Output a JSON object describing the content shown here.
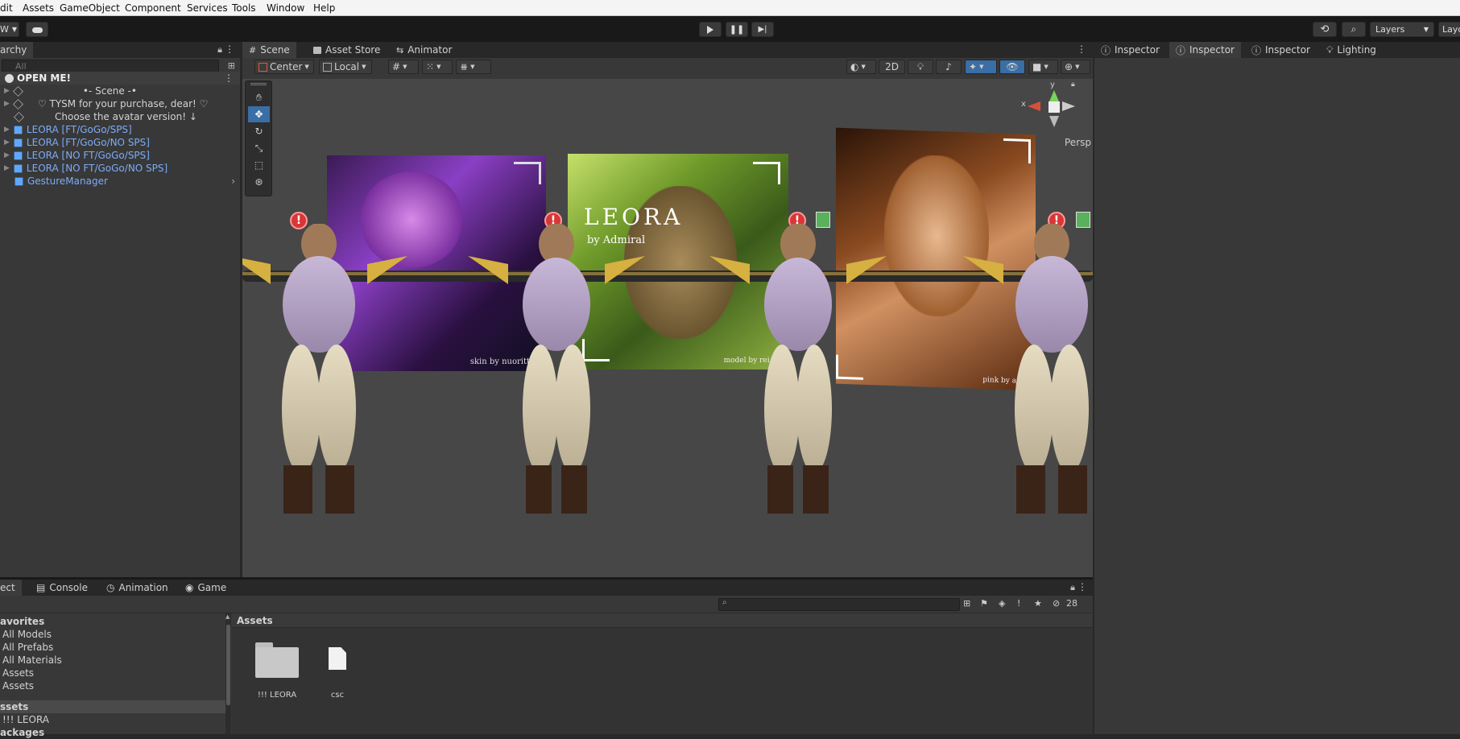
{
  "menu": [
    "dit",
    "Assets",
    "GameObject",
    "Component",
    "Services",
    "Tools",
    "Window",
    "Help"
  ],
  "toolbar": {
    "account_label": "W",
    "layers_label": "Layers",
    "layout_label": "Layo"
  },
  "hierarchy": {
    "tab_label": "archy",
    "search_placeholder": "All",
    "scene_name": "OPEN ME!",
    "items": [
      {
        "label": "•- Scene -•"
      },
      {
        "label": "♡ TYSM for your purchase, dear! ♡"
      },
      {
        "label": "Choose the avatar version! ↓"
      },
      {
        "label": "LEORA [FT/GoGo/SPS]"
      },
      {
        "label": "LEORA [FT/GoGo/NO SPS]"
      },
      {
        "label": "LEORA [NO FT/GoGo/SPS]"
      },
      {
        "label": "LEORA [NO FT/GoGo/NO SPS]"
      },
      {
        "label": "GestureManager"
      }
    ]
  },
  "scene_tabs": [
    {
      "label": "Scene"
    },
    {
      "label": "Asset Store"
    },
    {
      "label": "Animator"
    }
  ],
  "scene_toolbar": {
    "pivot": "Center",
    "space": "Local",
    "mode_2d": "2D"
  },
  "gizmo": {
    "y": "y",
    "x": "x",
    "projection": "Persp"
  },
  "posters": [
    {
      "title": "",
      "caption": "skin by nuoritt"
    },
    {
      "title": "LEORA",
      "subtitle": "by Admiral",
      "caption": "model by rei.ky"
    },
    {
      "title": "",
      "caption": "pink by ai-ly"
    }
  ],
  "inspector_tabs": [
    {
      "label": "Inspector"
    },
    {
      "label": "Inspector"
    },
    {
      "label": "Inspector"
    },
    {
      "label": "Lighting"
    }
  ],
  "bottom_tabs": [
    {
      "label": "ect"
    },
    {
      "label": "Console"
    },
    {
      "label": "Animation"
    },
    {
      "label": "Game"
    }
  ],
  "project": {
    "hidden_count": "28",
    "favorites_header": "avorites",
    "favorites": [
      "All Models",
      "All Prefabs",
      "All Materials",
      "Assets",
      "Assets"
    ],
    "assets_header": "ssets",
    "assets_children": [
      "!!! LEORA"
    ],
    "packages_header": "ackages",
    "breadcrumb": "Assets",
    "grid": [
      {
        "name": "!!! LEORA",
        "type": "folder"
      },
      {
        "name": "csc",
        "type": "file"
      }
    ]
  },
  "colors": {
    "accent": "#3a6ea5",
    "scene_bg": "#474747",
    "panel": "#383838",
    "warn": "#d83737"
  }
}
